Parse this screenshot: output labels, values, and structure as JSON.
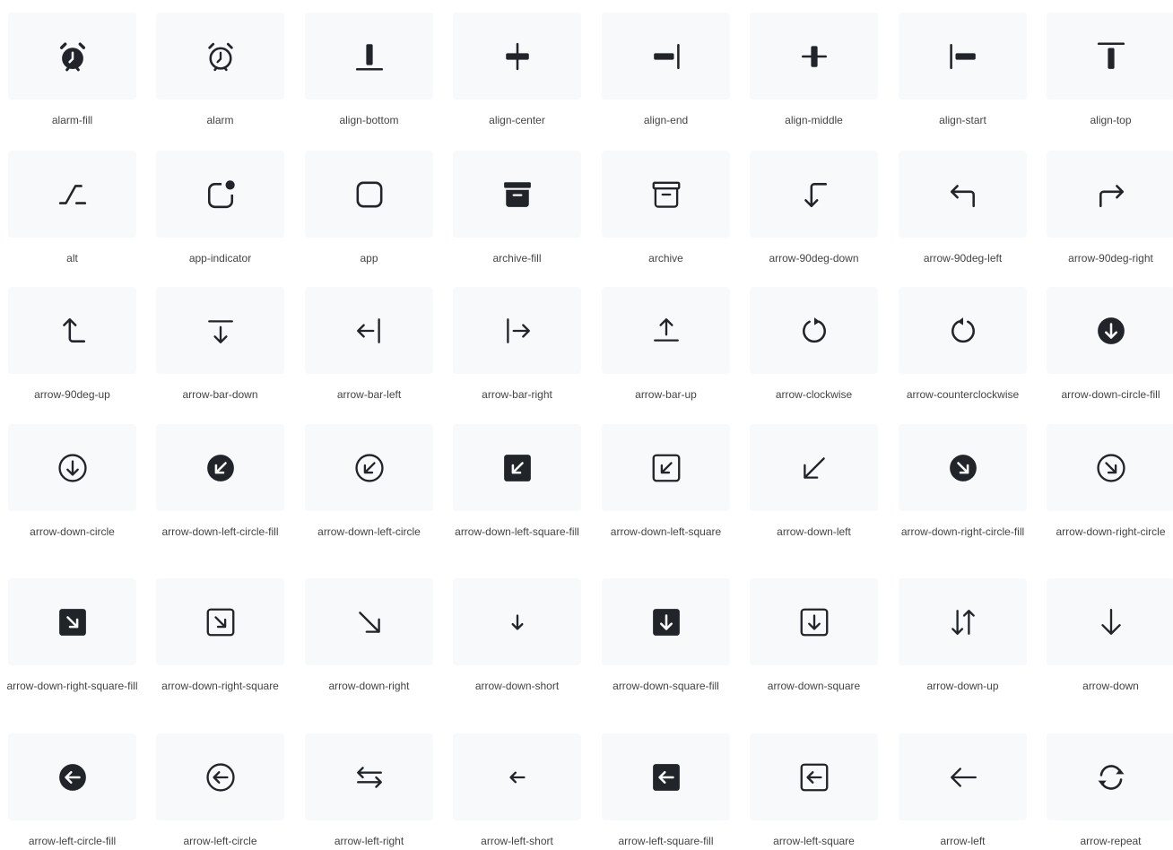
{
  "icons": [
    {
      "name": "alarm-fill",
      "icon": "alarm-fill-icon"
    },
    {
      "name": "alarm",
      "icon": "alarm-icon"
    },
    {
      "name": "align-bottom",
      "icon": "align-bottom-icon"
    },
    {
      "name": "align-center",
      "icon": "align-center-icon"
    },
    {
      "name": "align-end",
      "icon": "align-end-icon"
    },
    {
      "name": "align-middle",
      "icon": "align-middle-icon"
    },
    {
      "name": "align-start",
      "icon": "align-start-icon"
    },
    {
      "name": "align-top",
      "icon": "align-top-icon"
    },
    {
      "name": "alt",
      "icon": "alt-icon"
    },
    {
      "name": "app-indicator",
      "icon": "app-indicator-icon"
    },
    {
      "name": "app",
      "icon": "app-icon"
    },
    {
      "name": "archive-fill",
      "icon": "archive-fill-icon"
    },
    {
      "name": "archive",
      "icon": "archive-icon"
    },
    {
      "name": "arrow-90deg-down",
      "icon": "arrow-90deg-down-icon"
    },
    {
      "name": "arrow-90deg-left",
      "icon": "arrow-90deg-left-icon"
    },
    {
      "name": "arrow-90deg-right",
      "icon": "arrow-90deg-right-icon"
    },
    {
      "name": "arrow-90deg-up",
      "icon": "arrow-90deg-up-icon"
    },
    {
      "name": "arrow-bar-down",
      "icon": "arrow-bar-down-icon"
    },
    {
      "name": "arrow-bar-left",
      "icon": "arrow-bar-left-icon"
    },
    {
      "name": "arrow-bar-right",
      "icon": "arrow-bar-right-icon"
    },
    {
      "name": "arrow-bar-up",
      "icon": "arrow-bar-up-icon"
    },
    {
      "name": "arrow-clockwise",
      "icon": "arrow-clockwise-icon"
    },
    {
      "name": "arrow-counterclockwise",
      "icon": "arrow-counterclockwise-icon"
    },
    {
      "name": "arrow-down-circle-fill",
      "icon": "arrow-down-circle-fill-icon"
    },
    {
      "name": "arrow-down-circle",
      "icon": "arrow-down-circle-icon"
    },
    {
      "name": "arrow-down-left-circle-fill",
      "icon": "arrow-down-left-circle-fill-icon"
    },
    {
      "name": "arrow-down-left-circle",
      "icon": "arrow-down-left-circle-icon"
    },
    {
      "name": "arrow-down-left-square-fill",
      "icon": "arrow-down-left-square-fill-icon"
    },
    {
      "name": "arrow-down-left-square",
      "icon": "arrow-down-left-square-icon"
    },
    {
      "name": "arrow-down-left",
      "icon": "arrow-down-left-icon"
    },
    {
      "name": "arrow-down-right-circle-fill",
      "icon": "arrow-down-right-circle-fill-icon"
    },
    {
      "name": "arrow-down-right-circle",
      "icon": "arrow-down-right-circle-icon"
    },
    {
      "name": "arrow-down-right-square-fill",
      "icon": "arrow-down-right-square-fill-icon"
    },
    {
      "name": "arrow-down-right-square",
      "icon": "arrow-down-right-square-icon"
    },
    {
      "name": "arrow-down-right",
      "icon": "arrow-down-right-icon"
    },
    {
      "name": "arrow-down-short",
      "icon": "arrow-down-short-icon"
    },
    {
      "name": "arrow-down-square-fill",
      "icon": "arrow-down-square-fill-icon"
    },
    {
      "name": "arrow-down-square",
      "icon": "arrow-down-square-icon"
    },
    {
      "name": "arrow-down-up",
      "icon": "arrow-down-up-icon"
    },
    {
      "name": "arrow-down",
      "icon": "arrow-down-icon"
    },
    {
      "name": "arrow-left-circle-fill",
      "icon": "arrow-left-circle-fill-icon"
    },
    {
      "name": "arrow-left-circle",
      "icon": "arrow-left-circle-icon"
    },
    {
      "name": "arrow-left-right",
      "icon": "arrow-left-right-icon"
    },
    {
      "name": "arrow-left-short",
      "icon": "arrow-left-short-icon"
    },
    {
      "name": "arrow-left-square-fill",
      "icon": "arrow-left-square-fill-icon"
    },
    {
      "name": "arrow-left-square",
      "icon": "arrow-left-square-icon"
    },
    {
      "name": "arrow-left",
      "icon": "arrow-left-icon"
    },
    {
      "name": "arrow-repeat",
      "icon": "arrow-repeat-icon"
    }
  ]
}
